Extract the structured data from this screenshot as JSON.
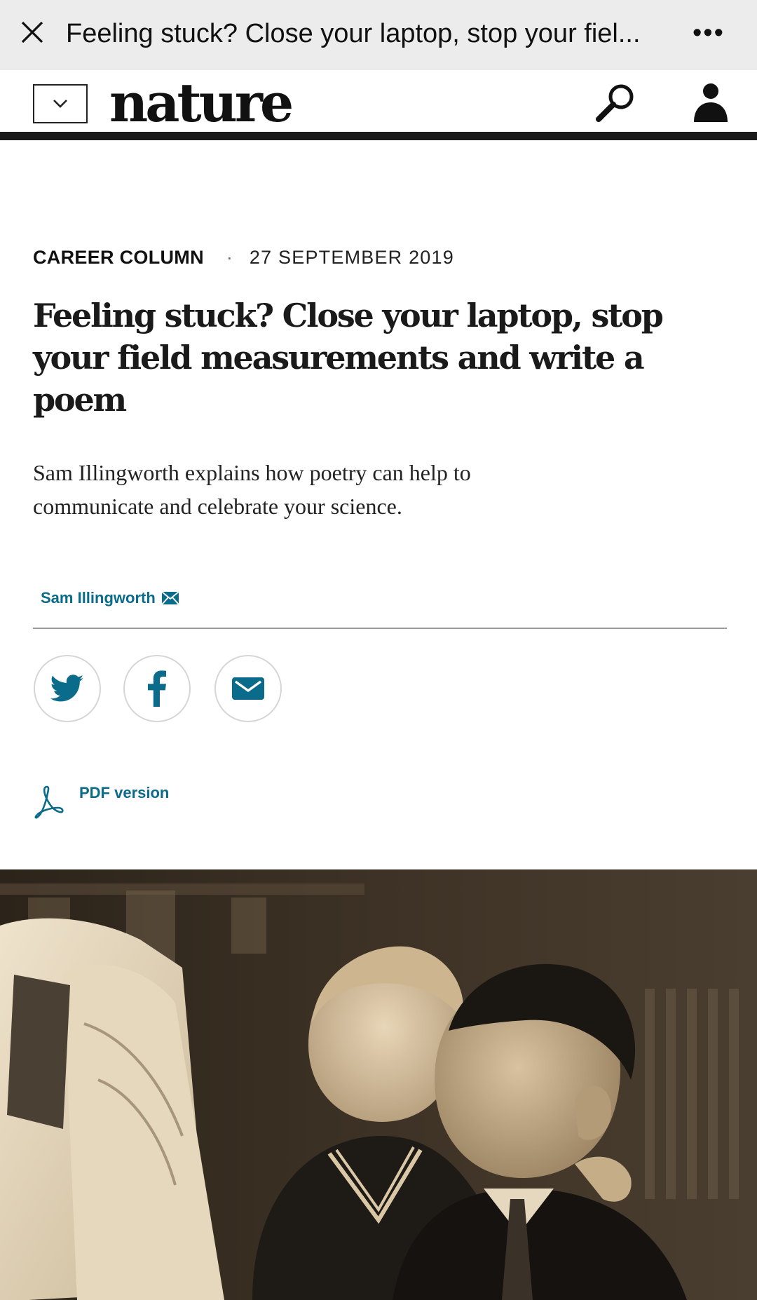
{
  "window": {
    "title": "Feeling stuck? Close your laptop, stop your fiel...",
    "more_label": "•••"
  },
  "header": {
    "logo": "nature"
  },
  "article": {
    "type": "CAREER COLUMN",
    "separator": "·",
    "date": "27 SEPTEMBER 2019",
    "headline": "Feeling stuck? Close your laptop, stop your field measurements and write a poem",
    "standfirst": "Sam Illingworth explains how poetry can help to communicate and celebrate your science.",
    "author": "Sam Illingworth",
    "pdf_label": "PDF version"
  },
  "colors": {
    "link": "#0b6b8a",
    "header_rule": "#1a1a1a",
    "topbar_bg": "#ececec"
  },
  "icons": {
    "close": "close-icon",
    "more": "more-icon",
    "menu": "chevron-down-icon",
    "search": "search-icon",
    "user": "user-icon",
    "twitter": "twitter-icon",
    "facebook": "facebook-icon",
    "email": "email-icon",
    "pdf": "pdf-icon"
  }
}
